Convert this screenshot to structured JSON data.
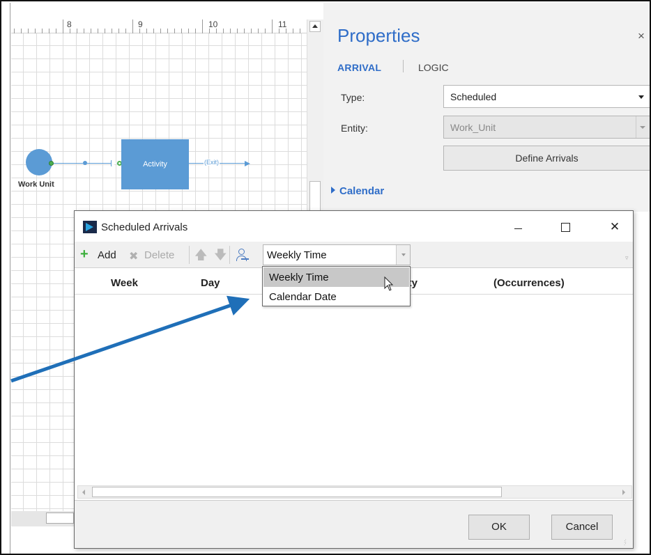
{
  "canvas": {
    "ruler_numbers": [
      "8",
      "9",
      "10",
      "11"
    ],
    "flow": {
      "source_label": "Work Unit",
      "activity_label": "Activity",
      "exit_label": "(Exit)"
    }
  },
  "properties": {
    "title": "Properties",
    "close_glyph": "×",
    "tabs": [
      "ARRIVAL",
      "LOGIC"
    ],
    "active_tab": "ARRIVAL",
    "type_label": "Type:",
    "type_value": "Scheduled",
    "entity_label": "Entity:",
    "entity_value": "Work_Unit",
    "define_button": "Define Arrivals",
    "calendar_section": "Calendar"
  },
  "dialog": {
    "title": "Scheduled Arrivals",
    "close_glyph": "✕",
    "toolbar": {
      "add_label": "Add",
      "delete_label": "Delete",
      "mode_value": "Weekly Time"
    },
    "columns": [
      "Week",
      "Day",
      "Qty",
      "(Occurrences)"
    ],
    "rows": [],
    "ok_label": "OK",
    "cancel_label": "Cancel"
  },
  "dropdown": {
    "options": [
      "Weekly Time",
      "Calendar Date"
    ],
    "highlighted": "Weekly Time"
  },
  "colors": {
    "accent": "#2f6dc8",
    "flow_shape": "#5b9bd5",
    "annotation_arrow": "#1f6fb8",
    "add_icon": "#3cae3c"
  },
  "icons": {
    "add": "plus-icon",
    "delete": "delete-x-icon",
    "move_up": "arrow-up-icon",
    "move_down": "arrow-down-icon",
    "resource": "user-icon",
    "app": "app-logo-icon"
  }
}
